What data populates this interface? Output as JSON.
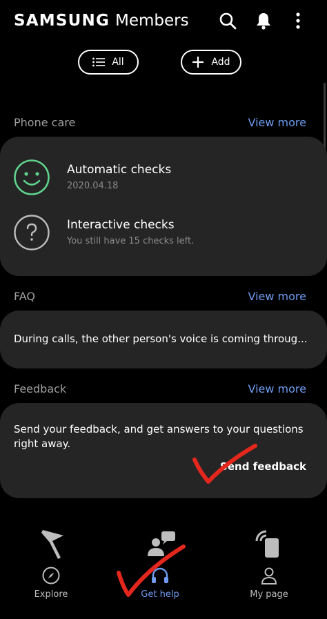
{
  "header": {
    "brand_bold": "SAMSUNG",
    "brand_rest": "Members",
    "icons": [
      "search-icon",
      "bell-icon",
      "more-vertical-icon"
    ]
  },
  "filters": {
    "all_label": "All",
    "add_label": "Add"
  },
  "phone_care": {
    "title": "Phone care",
    "view_more": "View more",
    "items": [
      {
        "title": "Automatic checks",
        "subtitle": "2020.04.18",
        "icon": "smiley-icon"
      },
      {
        "title": "Interactive checks",
        "subtitle": "You still have 15 checks left.",
        "icon": "question-icon"
      }
    ]
  },
  "faq": {
    "title": "FAQ",
    "view_more": "View more",
    "item": "During calls, the other person's voice is coming throug..."
  },
  "feedback": {
    "title": "Feedback",
    "view_more": "View more",
    "text": "Send your feedback, and get answers to your questions right away.",
    "action": "Send feedback"
  },
  "bottom_nav": {
    "items": [
      {
        "label": "Explore",
        "icon": "compass-icon",
        "active": false
      },
      {
        "label": "Get help",
        "icon": "headset-icon",
        "active": true
      },
      {
        "label": "My page",
        "icon": "person-icon",
        "active": false
      }
    ]
  },
  "colors": {
    "accent": "#6f9cf3",
    "check_good": "#5fd38d",
    "annotation": "#e3271d"
  }
}
